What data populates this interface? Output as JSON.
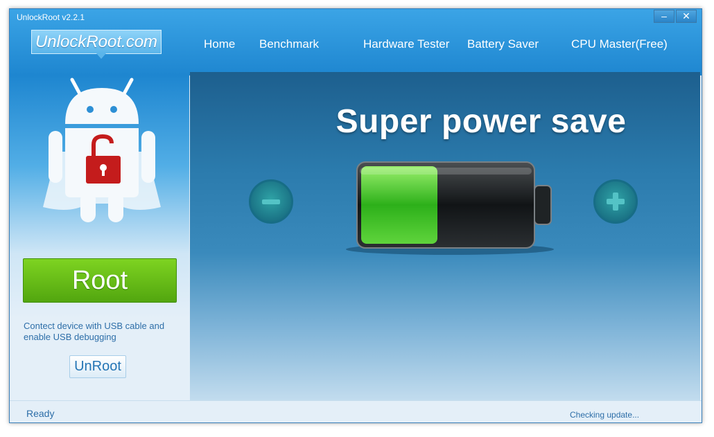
{
  "window": {
    "title": "UnlockRoot v2.2.1",
    "minimize_glyph": "–",
    "close_glyph": "✕"
  },
  "logo": {
    "text": "UnlockRoot.com"
  },
  "nav": {
    "home": "Home",
    "benchmark": "Benchmark",
    "hardware_tester": "Hardware Tester",
    "battery_saver": "Battery Saver",
    "cpu_master": "CPU Master(Free)"
  },
  "sidebar": {
    "root_label": "Root",
    "hint": "Contect device with USB cable and enable USB debugging",
    "unroot_label": "UnRoot"
  },
  "main": {
    "title": "Super power save",
    "battery_level": 0.45
  },
  "status": {
    "left": "Ready",
    "right": "Checking update..."
  },
  "colors": {
    "header": "#2a94da",
    "root_green": "#6cc31a",
    "battery_green": "#3dcc27",
    "text_blue": "#2d6ea8"
  },
  "icons": [
    "android-robot-icon",
    "padlock-icon",
    "minus-icon",
    "plus-icon",
    "battery-icon"
  ]
}
